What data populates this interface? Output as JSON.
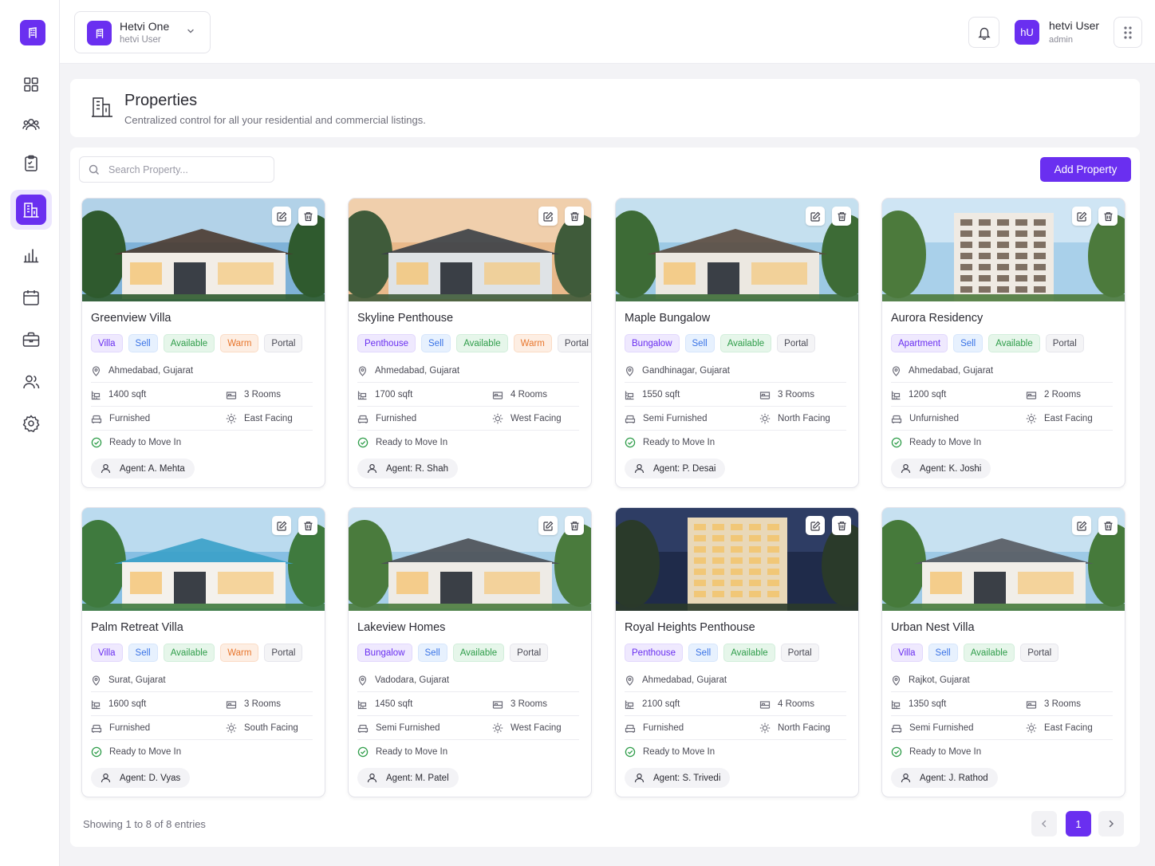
{
  "app": {
    "logo_icon": "building-logo-icon",
    "accent": "#6a2ff0"
  },
  "sidebar": {
    "items": [
      {
        "name": "dashboard",
        "icon": "grid-icon"
      },
      {
        "name": "users",
        "icon": "users-icon"
      },
      {
        "name": "tasks",
        "icon": "clipboard-icon"
      },
      {
        "name": "properties",
        "icon": "building-icon",
        "active": true
      },
      {
        "name": "analytics",
        "icon": "bar-chart-icon"
      },
      {
        "name": "calendar",
        "icon": "calendar-icon"
      },
      {
        "name": "deals",
        "icon": "briefcase-icon"
      },
      {
        "name": "contacts",
        "icon": "user-group-icon"
      },
      {
        "name": "settings",
        "icon": "gear-icon"
      }
    ]
  },
  "header": {
    "org_name": "Hetvi One",
    "org_user": "hetvi User",
    "avatar_initials": "hU",
    "user_name": "hetvi User",
    "user_role": "admin"
  },
  "page": {
    "title": "Properties",
    "subtitle": "Centralized control for all your residential and commercial listings."
  },
  "toolbar": {
    "search_placeholder": "Search Property...",
    "add_label": "Add Property"
  },
  "properties": [
    {
      "name": "Greenview Villa",
      "type": "Villa",
      "deal": "Sell",
      "status": "Available",
      "lead": "Warm",
      "source": "Portal",
      "location": "Ahmedabad, Gujarat",
      "area": "1400 sqft",
      "rooms": "3 Rooms",
      "furnishing": "Furnished",
      "facing": "East Facing",
      "possession": "Ready to Move In",
      "agent": "Agent: A. Mehta"
    },
    {
      "name": "Skyline Penthouse",
      "type": "Penthouse",
      "deal": "Sell",
      "status": "Available",
      "lead": "Warm",
      "source": "Portal",
      "location": "Ahmedabad, Gujarat",
      "area": "1700 sqft",
      "rooms": "4 Rooms",
      "furnishing": "Furnished",
      "facing": "West Facing",
      "possession": "Ready to Move In",
      "agent": "Agent: R. Shah"
    },
    {
      "name": "Maple Bungalow",
      "type": "Bungalow",
      "deal": "Sell",
      "status": "Available",
      "lead": null,
      "source": "Portal",
      "location": "Gandhinagar, Gujarat",
      "area": "1550 sqft",
      "rooms": "3 Rooms",
      "furnishing": "Semi Furnished",
      "facing": "North Facing",
      "possession": "Ready to Move In",
      "agent": "Agent: P. Desai"
    },
    {
      "name": "Aurora Residency",
      "type": "Apartment",
      "deal": "Sell",
      "status": "Available",
      "lead": null,
      "source": "Portal",
      "location": "Ahmedabad, Gujarat",
      "area": "1200 sqft",
      "rooms": "2 Rooms",
      "furnishing": "Unfurnished",
      "facing": "East Facing",
      "possession": "Ready to Move In",
      "agent": "Agent: K. Joshi"
    },
    {
      "name": "Palm Retreat Villa",
      "type": "Villa",
      "deal": "Sell",
      "status": "Available",
      "lead": "Warm",
      "source": "Portal",
      "location": "Surat, Gujarat",
      "area": "1600 sqft",
      "rooms": "3 Rooms",
      "furnishing": "Furnished",
      "facing": "South Facing",
      "possession": "Ready to Move In",
      "agent": "Agent: D. Vyas"
    },
    {
      "name": "Lakeview Homes",
      "type": "Bungalow",
      "deal": "Sell",
      "status": "Available",
      "lead": null,
      "source": "Portal",
      "location": "Vadodara, Gujarat",
      "area": "1450 sqft",
      "rooms": "3 Rooms",
      "furnishing": "Semi Furnished",
      "facing": "West Facing",
      "possession": "Ready to Move In",
      "agent": "Agent: M. Patel"
    },
    {
      "name": "Royal Heights Penthouse",
      "type": "Penthouse",
      "deal": "Sell",
      "status": "Available",
      "lead": null,
      "source": "Portal",
      "location": "Ahmedabad, Gujarat",
      "area": "2100 sqft",
      "rooms": "4 Rooms",
      "furnishing": "Furnished",
      "facing": "North Facing",
      "possession": "Ready to Move In",
      "agent": "Agent: S. Trivedi"
    },
    {
      "name": "Urban Nest Villa",
      "type": "Villa",
      "deal": "Sell",
      "status": "Available",
      "lead": null,
      "source": "Portal",
      "location": "Rajkot, Gujarat",
      "area": "1350 sqft",
      "rooms": "3 Rooms",
      "furnishing": "Semi Furnished",
      "facing": "East Facing",
      "possession": "Ready to Move In",
      "agent": "Agent: J. Rathod"
    }
  ],
  "footer": {
    "showing": "Showing 1 to 8 of 8 entries",
    "current_page": "1",
    "prev_icon": "chevron-left-icon",
    "next_icon": "chevron-right-icon"
  }
}
